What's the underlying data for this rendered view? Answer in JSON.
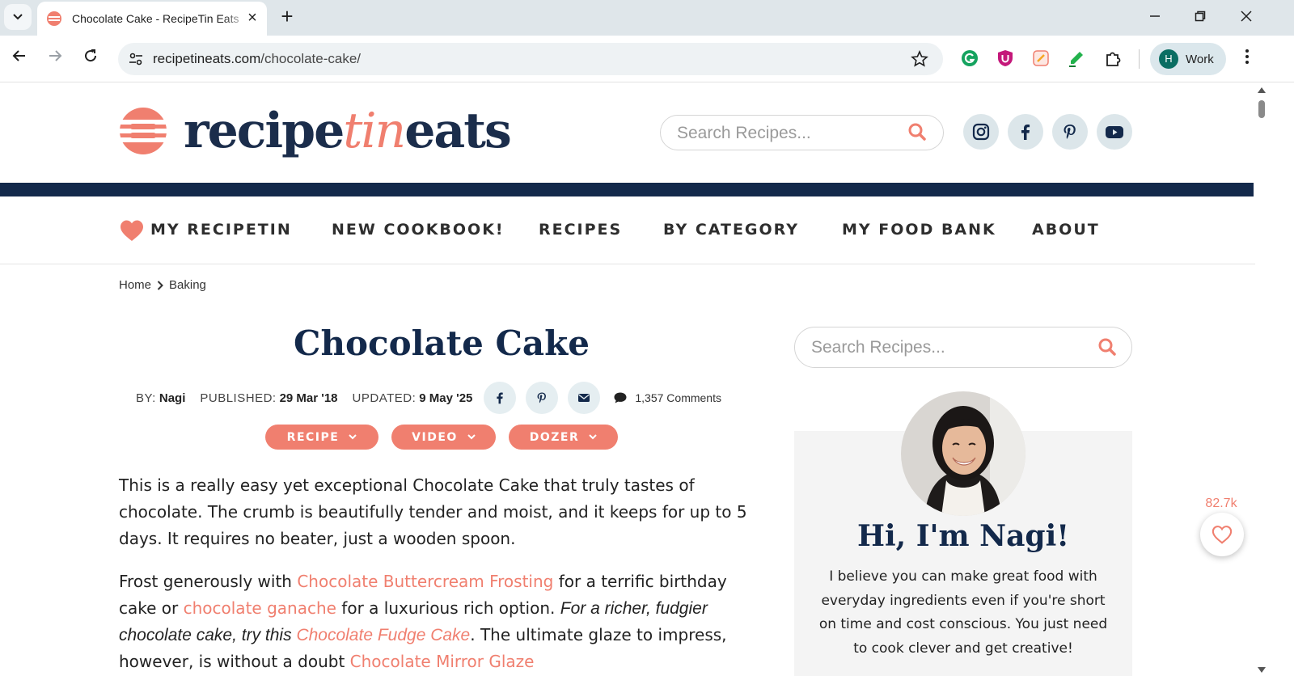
{
  "browser": {
    "tab_title": "Chocolate Cake - RecipeTin Eats",
    "url_domain": "recipetineats.com",
    "url_path": "/chocolate-cake/",
    "profile_initial": "H",
    "profile_label": "Work"
  },
  "header": {
    "logo_part1": "recipe",
    "logo_part2": "tin",
    "logo_part3": "eats",
    "search_placeholder": "Search Recipes..."
  },
  "nav": {
    "items": [
      "MY RECIPETIN",
      "NEW COOKBOOK!",
      "RECIPES",
      "BY CATEGORY",
      "MY FOOD BANK",
      "ABOUT"
    ]
  },
  "breadcrumb": [
    "Home",
    "Baking"
  ],
  "article": {
    "title": "Chocolate Cake",
    "by_label": "BY:",
    "author": "Nagi",
    "published_label": "PUBLISHED:",
    "published": "29 Mar '18",
    "updated_label": "UPDATED:",
    "updated": "9 May '25",
    "comments": "1,357 Comments",
    "jump_buttons": [
      "RECIPE",
      "VIDEO",
      "DOZER"
    ],
    "para1": "This is a really easy yet exceptional Chocolate Cake that truly tastes of chocolate. The crumb is beautifully tender and moist, and it keeps for up to 5 days. It requires no beater, just a wooden spoon.",
    "para2_a": "Frost generously with ",
    "para2_link1": "Chocolate Buttercream Frosting",
    "para2_b": " for a terrific birthday cake or ",
    "para2_link2": "chocolate ganache",
    "para2_c": " for a luxurious rich option. ",
    "para2_em": "For a richer, fudgier chocolate cake, try this ",
    "para2_link3": "Chocolate Fudge Cake",
    "para2_d": ". The ultimate glaze to impress, however, is without a doubt ",
    "para2_link4": "Chocolate Mirror Glaze"
  },
  "sidebar": {
    "search_placeholder": "Search Recipes...",
    "greeting": "Hi, I'm Nagi!",
    "about": "I believe you can make great food with everyday ingredients even if you're short on time and cost conscious. You just need to cook clever and get creative!"
  },
  "favorites": {
    "count": "82.7k"
  },
  "colors": {
    "brand_navy": "#13294b",
    "brand_coral": "#f07f6f",
    "card_bg": "#f4f4f4"
  },
  "icons": [
    "search-icon",
    "instagram-icon",
    "facebook-icon",
    "pinterest-icon",
    "youtube-icon",
    "heart-icon",
    "email-icon",
    "comment-icon",
    "chevron-right-icon",
    "chevron-down-icon"
  ]
}
